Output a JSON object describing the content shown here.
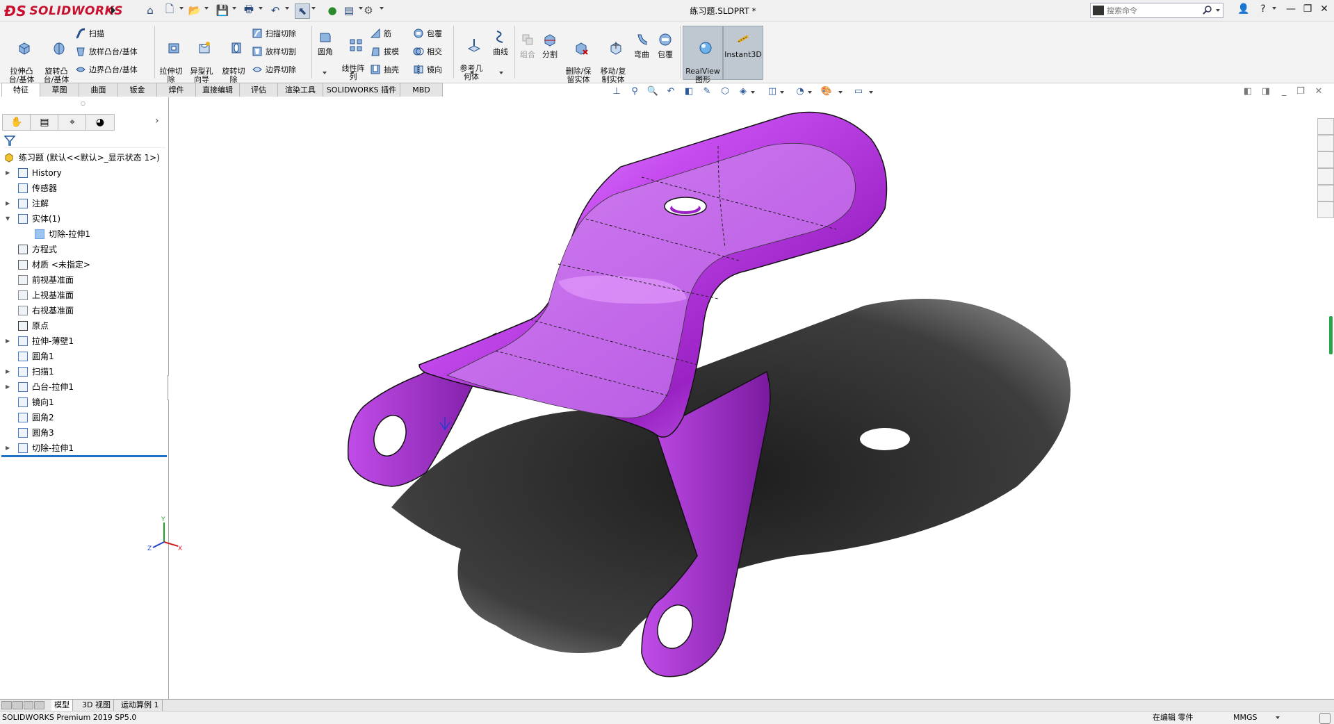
{
  "titlebar": {
    "brand": "SOLIDWORKS",
    "document_title": "练习题.SLDPRT *",
    "search_placeholder": "搜索命令",
    "help_label": "?",
    "minimize": "—",
    "restore": "❐",
    "close": "✕"
  },
  "ribbon": {
    "extrude_boss": "拉伸凸\n台/基体",
    "revolve_boss": "旋转凸\n台/基体",
    "sweep": "扫描",
    "loft_boss": "放样凸台/基体",
    "boundary_boss": "边界凸台/基体",
    "extrude_cut": "拉伸切\n除",
    "hole_wizard": "异型孔\n向导",
    "revolve_cut": "旋转切\n除",
    "swept_cut": "扫描切除",
    "lofted_cut": "放样切割",
    "boundary_cut": "边界切除",
    "fillet": "圆角",
    "linear_pattern": "线性阵\n列",
    "rib": "筋",
    "draft": "拔模",
    "shell": "抽壳",
    "wrap": "包覆",
    "intersect": "相交",
    "mirror": "镜向",
    "ref_geometry": "参考几\n何体",
    "curves": "曲线",
    "combine": "组合",
    "split": "分割",
    "delete_keep_body": "删除/保\n留实体",
    "move_copy_body": "移动/复\n制实体",
    "flex": "弯曲",
    "wrap2": "包覆",
    "realview": "RealView\n图形",
    "instant3d": "Instant3D"
  },
  "tabs": [
    "特征",
    "草图",
    "曲面",
    "钣金",
    "焊件",
    "直接编辑",
    "评估",
    "渲染工具",
    "SOLIDWORKS 插件",
    "MBD"
  ],
  "tree": {
    "root": "练习题 (默认<<默认>_显示状态 1>)",
    "items": [
      {
        "label": "History",
        "icon": "history-icon",
        "expand": true
      },
      {
        "label": "传感器",
        "icon": "sensor-icon",
        "expand": false
      },
      {
        "label": "注解",
        "icon": "annotation-icon",
        "expand": true
      },
      {
        "label": "实体(1)",
        "icon": "solid-bodies-icon",
        "expand": "open"
      },
      {
        "label": "切除-拉伸1",
        "icon": "body-icon",
        "expand": false,
        "child": true
      },
      {
        "label": "方程式",
        "icon": "equation-icon",
        "expand": false
      },
      {
        "label": "材质 <未指定>",
        "icon": "material-icon",
        "expand": false
      },
      {
        "label": "前视基准面",
        "icon": "plane-icon",
        "expand": false
      },
      {
        "label": "上视基准面",
        "icon": "plane-icon",
        "expand": false
      },
      {
        "label": "右视基准面",
        "icon": "plane-icon",
        "expand": false
      },
      {
        "label": "原点",
        "icon": "origin-icon",
        "expand": false
      },
      {
        "label": "拉伸-薄壁1",
        "icon": "extrude-icon",
        "expand": true
      },
      {
        "label": "圆角1",
        "icon": "fillet-icon",
        "expand": false
      },
      {
        "label": "扫描1",
        "icon": "sweep-icon",
        "expand": true
      },
      {
        "label": "凸台-拉伸1",
        "icon": "extrude-icon",
        "expand": true
      },
      {
        "label": "镜向1",
        "icon": "mirror-icon",
        "expand": false
      },
      {
        "label": "圆角2",
        "icon": "fillet-icon",
        "expand": false
      },
      {
        "label": "圆角3",
        "icon": "fillet-icon",
        "expand": false
      },
      {
        "label": "切除-拉伸1",
        "icon": "cut-extrude-icon",
        "expand": true
      }
    ]
  },
  "bottom_tabs": [
    "模型",
    "3D 视图",
    "运动算例 1"
  ],
  "status": {
    "product": "SOLIDWORKS Premium 2019 SP5.0",
    "mode": "在编辑 零件",
    "units": "MMGS"
  },
  "colors": {
    "part": "#b430e6",
    "part_light": "#e08cff",
    "part_dark": "#6a127f",
    "accent": "#1f73c7"
  }
}
